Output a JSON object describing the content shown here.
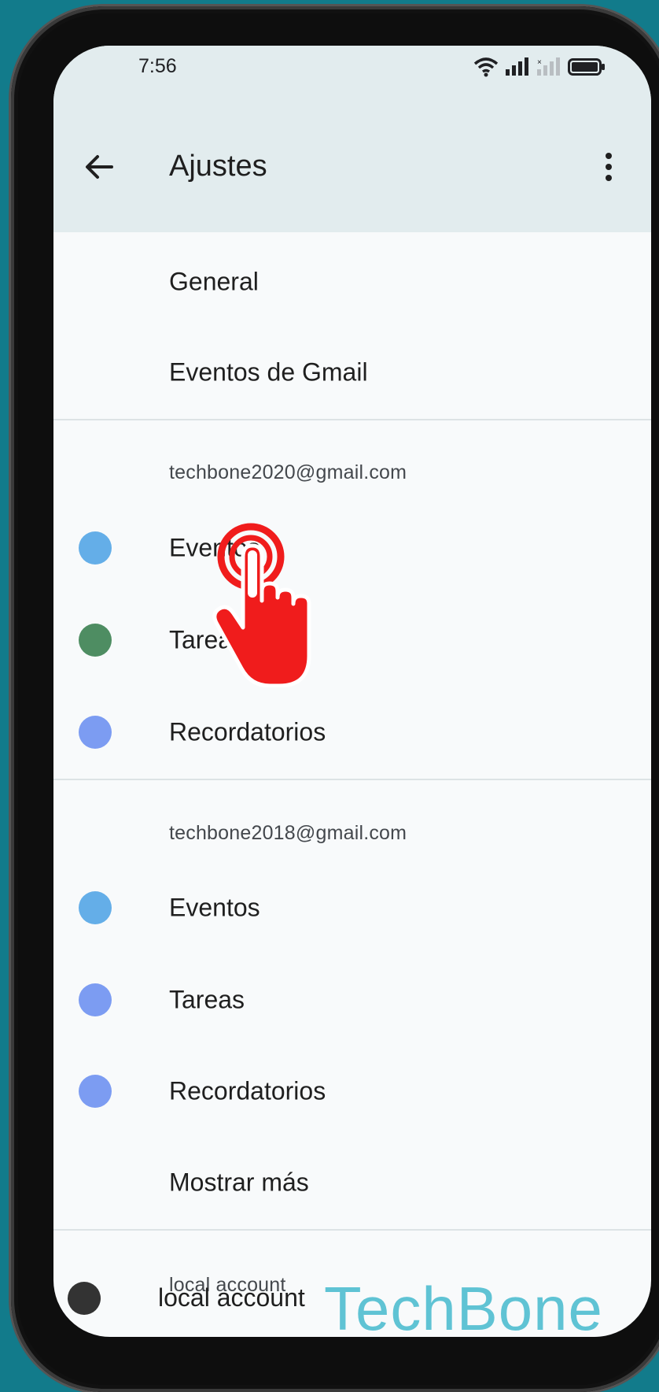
{
  "status_bar": {
    "time": "7:56",
    "icons": [
      "wifi-icon",
      "signal-icon",
      "signal-no-sim-icon",
      "battery-icon"
    ]
  },
  "app_bar": {
    "title": "Ajustes",
    "back_icon": "arrow-back-icon",
    "menu_icon": "more-vert-icon"
  },
  "general_items": [
    {
      "label": "General"
    },
    {
      "label": "Eventos de Gmail"
    }
  ],
  "accounts": [
    {
      "header": "techbone2020@gmail.com",
      "calendars": [
        {
          "label": "Eventos",
          "color": "#64aee8"
        },
        {
          "label": "Tareas",
          "color": "#4e8d62"
        },
        {
          "label": "Recordatorios",
          "color": "#7c9cf2"
        }
      ]
    },
    {
      "header": "techbone2018@gmail.com",
      "calendars": [
        {
          "label": "Eventos",
          "color": "#64aee8"
        },
        {
          "label": "Tareas",
          "color": "#7c9cf2"
        },
        {
          "label": "Recordatorios",
          "color": "#7c9cf2"
        }
      ],
      "show_more": "Mostrar más"
    },
    {
      "header": "local account",
      "calendars": [
        {
          "label": "local account",
          "color": "#333333"
        }
      ]
    }
  ],
  "watermark": "TechBone",
  "colors": {
    "background": "#127b8b",
    "app_bar": "#e2ecee",
    "touch_hand": "#f01c1c"
  }
}
